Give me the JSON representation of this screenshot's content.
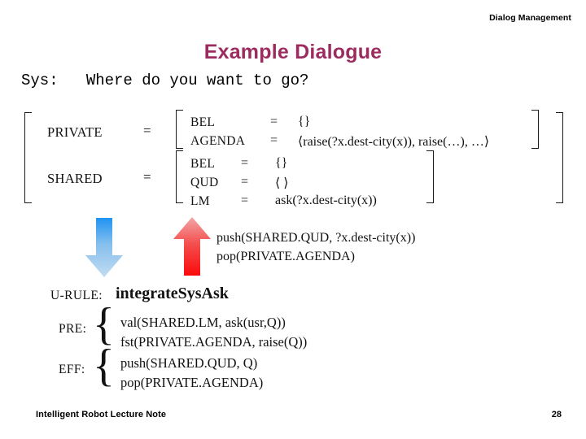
{
  "header": {
    "running_head": "Dialog Management"
  },
  "title": "Example Dialogue",
  "accent_color": "#9c2c5f",
  "dialogue": {
    "speaker_turn": "Sys:   Where do you want to go?"
  },
  "information_state": {
    "outer_rows": [
      {
        "label": "PRIVATE",
        "equals": "="
      },
      {
        "label": "SHARED",
        "equals": "="
      }
    ],
    "private_attributes": [
      {
        "attr": "BEL",
        "equals": "=",
        "value": "{}"
      },
      {
        "attr": "AGENDA",
        "equals": "=",
        "value": "⟨raise(?x.dest-city(x)), raise(…), …⟩"
      }
    ],
    "shared_attributes": [
      {
        "attr": "BEL",
        "equals": "=",
        "value": "{}"
      },
      {
        "attr": "QUD",
        "equals": "=",
        "value": "⟨ ⟩"
      },
      {
        "attr": "LM",
        "equals": "=",
        "value": "ask(?x.dest-city(x))"
      }
    ]
  },
  "arrows": {
    "down": {
      "name": "blue-down-arrow",
      "color_top": "#2f9ef4",
      "color_bottom": "#bcd9f0"
    },
    "up": {
      "name": "red-up-arrow",
      "color_top": "#f0a0a0",
      "color_bottom": "#fa0d0d"
    }
  },
  "update_operations": [
    "push(SHARED.QUD, ?x.dest-city(x))",
    "pop(PRIVATE.AGENDA)"
  ],
  "rule": {
    "urule_label": "U-RULE:",
    "rule_name": "integrateSysAsk",
    "pre_label": "PRE:",
    "pre_lines": [
      "val(SHARED.LM, ask(usr,Q))",
      "fst(PRIVATE.AGENDA, raise(Q))"
    ],
    "eff_label": "EFF:",
    "eff_lines": [
      "push(SHARED.QUD, Q)",
      "pop(PRIVATE.AGENDA)"
    ]
  },
  "footer": {
    "note": "Intelligent Robot Lecture Note",
    "page_number": "28"
  }
}
